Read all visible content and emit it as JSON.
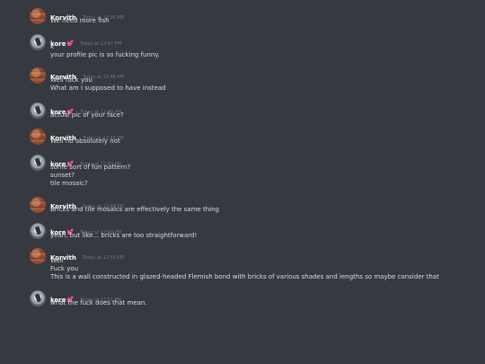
{
  "channel": {
    "messages": [
      {
        "author": "Korvith",
        "avatar": "brick-avatar",
        "badge": "",
        "time": "Today at 12:35 PM",
        "lines": [
          "We need more fish"
        ]
      },
      {
        "author": "kore",
        "avatar": "kore-avatar",
        "badge": "💕",
        "time": "Today at 12:47 PM",
        "lines": [
          "k",
          "your profile pic is so fucking funny."
        ]
      },
      {
        "author": "Korvith",
        "avatar": "brick-avatar",
        "badge": "",
        "time": "Today at 12:48 PM",
        "lines": [
          "Well fuck you",
          "What am I supposed to have instead"
        ]
      },
      {
        "author": "kore",
        "avatar": "kore-avatar",
        "badge": "💕",
        "time": "Today at 12:48 PM",
        "lines": [
          "actual pic of your face?"
        ]
      },
      {
        "author": "Korvith",
        "avatar": "brick-avatar",
        "badge": "",
        "time": "Today at 12:49 PM",
        "lines": [
          "Well no absolutely not"
        ]
      },
      {
        "author": "kore",
        "avatar": "kore-avatar",
        "badge": "💕",
        "time": "Today at 12:49 PM",
        "lines": [
          "some sort of fun pattern?",
          "sunset?",
          "tile mosaic?"
        ]
      },
      {
        "author": "Korvith",
        "avatar": "brick-avatar",
        "badge": "",
        "time": "Today at 12:49 PM",
        "lines": [
          "Bricks and tile mosaics are effectively the same thing"
        ]
      },
      {
        "author": "kore",
        "avatar": "kore-avatar",
        "badge": "💕",
        "time": "Today at 12:50 PM",
        "lines": [
          "yeah, but like... bricks are too straightforward!"
        ]
      },
      {
        "author": "Korvith",
        "avatar": "brick-avatar",
        "badge": "",
        "time": "Today at 12:50 PM",
        "lines": [
          "Well",
          "Fuck you",
          "This is a wall constructed in glazed-headed Flemish bond with bricks of various shades and lengths so maybe consider that"
        ]
      },
      {
        "author": "kore",
        "avatar": "kore-avatar",
        "badge": "💕",
        "time": "Today at 12:51 PM",
        "lines": [
          "what the fuck does that mean."
        ]
      }
    ]
  }
}
